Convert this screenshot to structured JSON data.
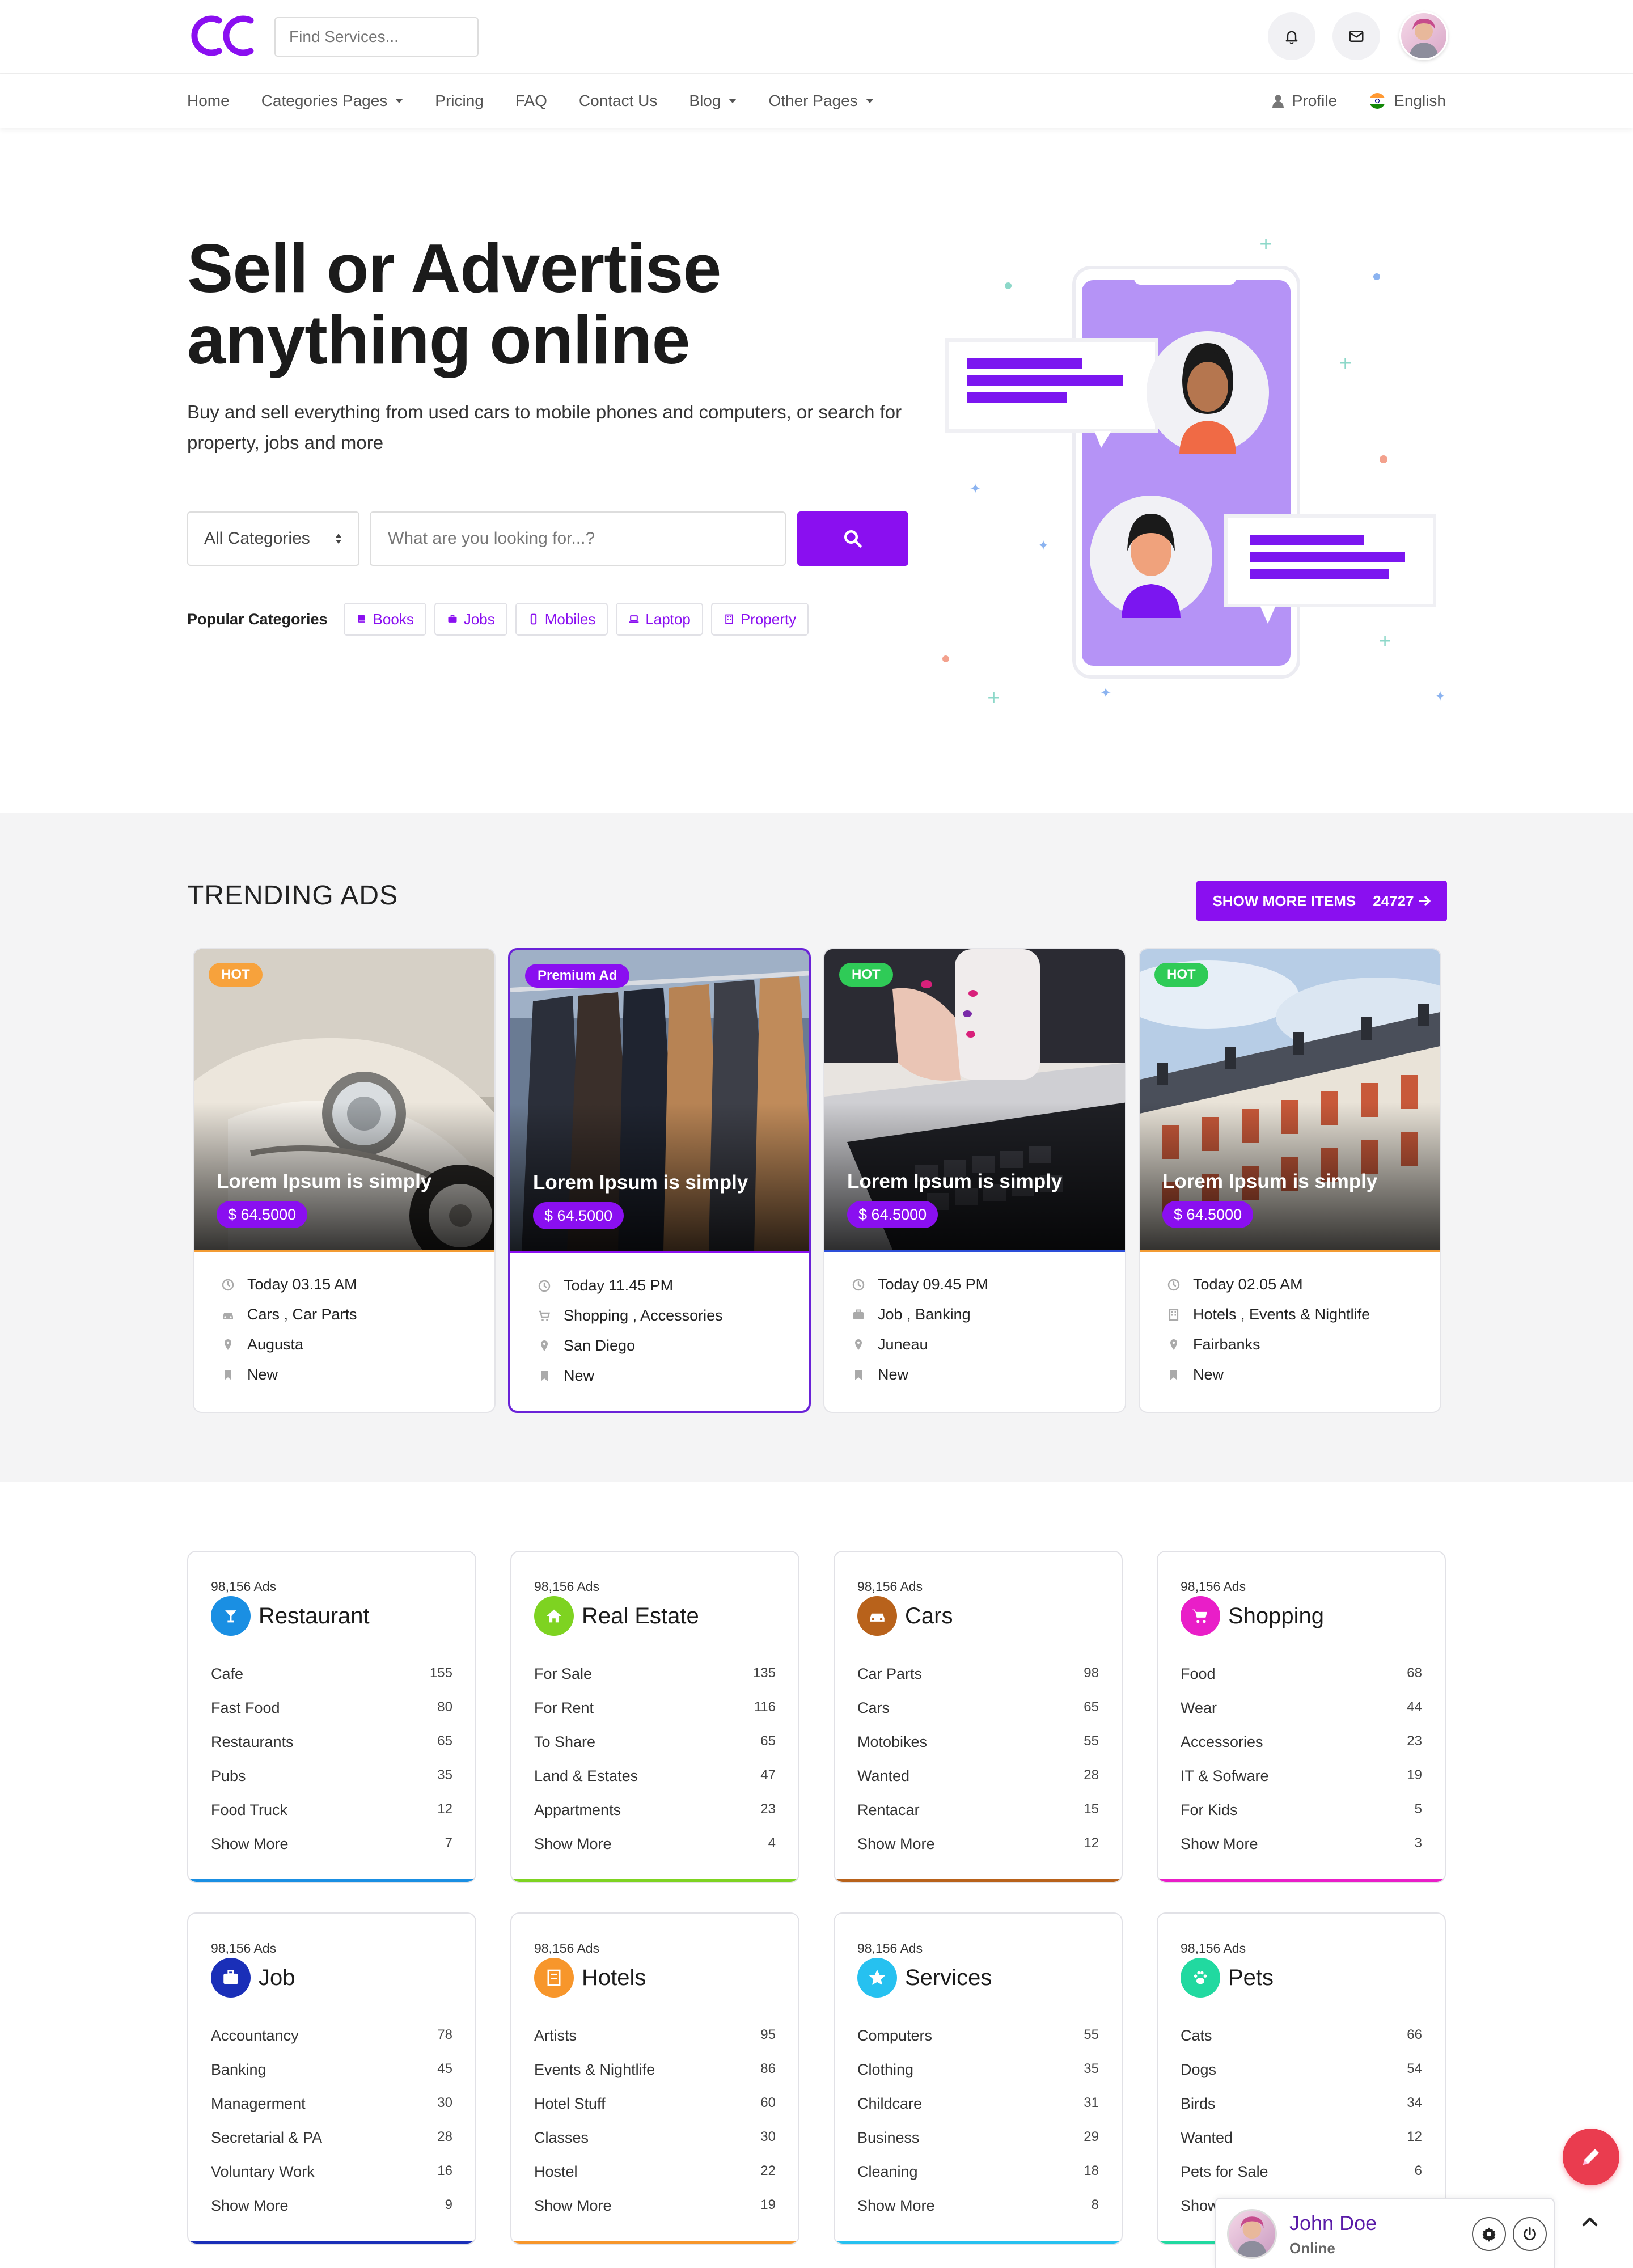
{
  "header": {
    "search_placeholder": "Find Services...",
    "nav": [
      "Home",
      "Categories Pages",
      "Pricing",
      "FAQ",
      "Contact Us",
      "Blog",
      "Other Pages"
    ],
    "nav_dropdown": [
      false,
      true,
      false,
      false,
      false,
      true,
      true
    ],
    "profile_label": "Profile",
    "language_label": "English",
    "icons": [
      "search-icon",
      "bell-icon",
      "mail-icon",
      "user-icon",
      "india-flag-icon"
    ]
  },
  "hero": {
    "title_line1": "Sell or Advertise",
    "title_line2": "anything online",
    "description": "Buy and sell everything from used cars to mobile phones and computers, or search for property, jobs and more",
    "category_select": "All Categories",
    "search_placeholder": "What are you looking for...?",
    "popular_label": "Popular Categories",
    "popular": [
      "Books",
      "Jobs",
      "Mobiles",
      "Laptop",
      "Property"
    ]
  },
  "trending": {
    "title": "TRENDING ADS",
    "show_more_label": "SHOW MORE ITEMS",
    "show_more_count": "24727",
    "ads": [
      {
        "badge": "HOT",
        "badge_color": "#f7a23c",
        "title": "Lorem Ipsum is simply",
        "price": "$ 64.5000",
        "time": "Today 03.15 AM",
        "category": "Cars , Car Parts",
        "location": "Augusta",
        "condition": "New",
        "underline": "#f39c34",
        "category_icon": "car-icon"
      },
      {
        "badge": "Premium Ad",
        "badge_color": "#8a0ff0",
        "title": "Lorem Ipsum is simply",
        "price": "$ 64.5000",
        "time": "Today 11.45 PM",
        "category": "Shopping , Accessories",
        "location": "San Diego",
        "condition": "New",
        "underline": "#8a0ff0",
        "category_icon": "cart-icon"
      },
      {
        "badge": "HOT",
        "badge_color": "#2fcb57",
        "title": "Lorem Ipsum is simply",
        "price": "$ 64.5000",
        "time": "Today 09.45 PM",
        "category": "Job , Banking",
        "location": "Juneau",
        "condition": "New",
        "underline": "#2d4fd9",
        "category_icon": "briefcase-icon"
      },
      {
        "badge": "HOT",
        "badge_color": "#2fcb57",
        "title": "Lorem Ipsum is simply",
        "price": "$ 64.5000",
        "time": "Today 02.05 AM",
        "category": "Hotels , Events & Nightlife",
        "location": "Fairbanks",
        "condition": "New",
        "underline": "#f39c34",
        "category_icon": "building-icon"
      }
    ]
  },
  "categories": [
    {
      "ads": "98,156 Ads",
      "name": "Restaurant",
      "color": "#1a8fe3",
      "icon": "cocktail-icon",
      "items": [
        [
          "Cafe",
          "155"
        ],
        [
          "Fast Food",
          "80"
        ],
        [
          "Restaurants",
          "65"
        ],
        [
          "Pubs",
          "35"
        ],
        [
          "Food Truck",
          "12"
        ],
        [
          "Show More",
          "7"
        ]
      ]
    },
    {
      "ads": "98,156 Ads",
      "name": "Real Estate",
      "color": "#7ed321",
      "icon": "home-icon",
      "items": [
        [
          "For Sale",
          "135"
        ],
        [
          "For Rent",
          "116"
        ],
        [
          "To Share",
          "65"
        ],
        [
          "Land & Estates",
          "47"
        ],
        [
          "Appartments",
          "23"
        ],
        [
          "Show More",
          "4"
        ]
      ]
    },
    {
      "ads": "98,156 Ads",
      "name": "Cars",
      "color": "#b8621b",
      "icon": "car-icon",
      "items": [
        [
          "Car Parts",
          "98"
        ],
        [
          "Cars",
          "65"
        ],
        [
          "Motobikes",
          "55"
        ],
        [
          "Wanted",
          "28"
        ],
        [
          "Rentacar",
          "15"
        ],
        [
          "Show More",
          "12"
        ]
      ]
    },
    {
      "ads": "98,156 Ads",
      "name": "Shopping",
      "color": "#e91ec8",
      "icon": "cart-icon",
      "items": [
        [
          "Food",
          "68"
        ],
        [
          "Wear",
          "44"
        ],
        [
          "Accessories",
          "23"
        ],
        [
          "IT & Sofware",
          "19"
        ],
        [
          "For Kids",
          "5"
        ],
        [
          "Show More",
          "3"
        ]
      ]
    },
    {
      "ads": "98,156 Ads",
      "name": "Job",
      "color": "#1a2fb8",
      "icon": "briefcase-icon",
      "items": [
        [
          "Accountancy",
          "78"
        ],
        [
          "Banking",
          "45"
        ],
        [
          "Managerment",
          "30"
        ],
        [
          "Secretarial & PA",
          "28"
        ],
        [
          "Voluntary Work",
          "16"
        ],
        [
          "Show More",
          "9"
        ]
      ]
    },
    {
      "ads": "98,156 Ads",
      "name": "Hotels",
      "color": "#f7962b",
      "icon": "building-icon",
      "items": [
        [
          "Artists",
          "95"
        ],
        [
          "Events & Nightlife",
          "86"
        ],
        [
          "Hotel Stuff",
          "60"
        ],
        [
          "Classes",
          "30"
        ],
        [
          "Hostel",
          "22"
        ],
        [
          "Show More",
          "19"
        ]
      ]
    },
    {
      "ads": "98,156 Ads",
      "name": "Services",
      "color": "#26c1f0",
      "icon": "star-icon",
      "items": [
        [
          "Computers",
          "55"
        ],
        [
          "Clothing",
          "35"
        ],
        [
          "Childcare",
          "31"
        ],
        [
          "Business",
          "29"
        ],
        [
          "Cleaning",
          "18"
        ],
        [
          "Show More",
          "8"
        ]
      ]
    },
    {
      "ads": "98,156 Ads",
      "name": "Pets",
      "color": "#21d9a0",
      "icon": "paw-icon",
      "items": [
        [
          "Cats",
          "66"
        ],
        [
          "Dogs",
          "54"
        ],
        [
          "Birds",
          "34"
        ],
        [
          "Wanted",
          "12"
        ],
        [
          "Pets for Sale",
          "6"
        ],
        [
          "Show More",
          ""
        ]
      ]
    }
  ],
  "chat": {
    "name": "John Doe",
    "status": "Online"
  }
}
